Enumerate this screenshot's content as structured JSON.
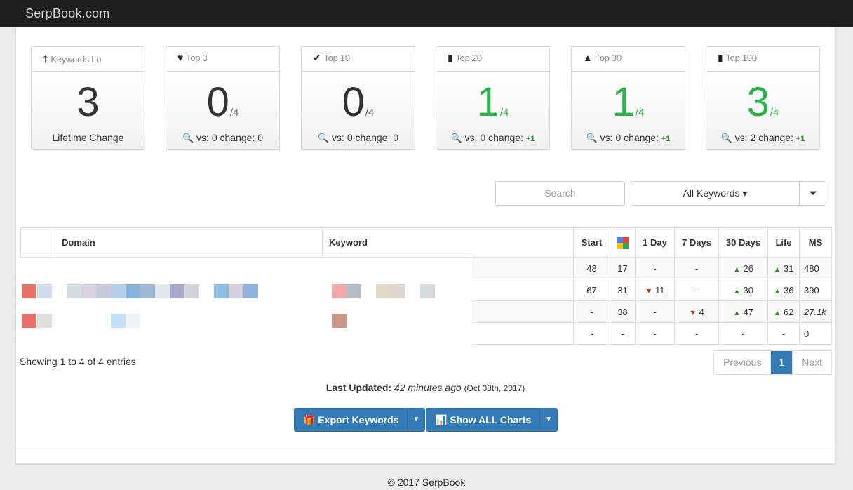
{
  "app": {
    "brand": "SerpBook.com"
  },
  "stats": [
    {
      "icon": "arrow-up-icon",
      "glyph": "🡑",
      "title": "Keywords Lo",
      "value": "3",
      "denominator": "",
      "green": false,
      "footer": "Lifetime Change",
      "vs": "",
      "change": "",
      "change_plus": ""
    },
    {
      "icon": "heart-icon",
      "glyph": "♥",
      "title": "Top 3",
      "value": "0",
      "denominator": "/4",
      "green": false,
      "footer": "",
      "vs": "vs: 0",
      "change": "change: 0",
      "change_plus": ""
    },
    {
      "icon": "check-icon",
      "glyph": "✔",
      "title": "Top 10",
      "value": "0",
      "denominator": "/4",
      "green": false,
      "footer": "",
      "vs": "vs: 0",
      "change": "change: 0",
      "change_plus": ""
    },
    {
      "icon": "bookmark-icon",
      "glyph": "🔖",
      "title": "Top 20",
      "value": "1",
      "denominator": "/4",
      "green": true,
      "footer": "",
      "vs": "vs: 0",
      "change": "change:",
      "change_plus": "+1"
    },
    {
      "icon": "road-icon",
      "glyph": "▲",
      "title": "Top 30",
      "value": "1",
      "denominator": "/4",
      "green": true,
      "footer": "",
      "vs": "vs: 0",
      "change": "change:",
      "change_plus": "+1"
    },
    {
      "icon": "signal-icon",
      "glyph": "▮",
      "title": "Top 100",
      "value": "3",
      "denominator": "/4",
      "green": true,
      "footer": "",
      "vs": "vs: 2",
      "change": "change:",
      "change_plus": "+1"
    }
  ],
  "toolbar": {
    "search_placeholder": "Search",
    "filter_label": "All Keywords ▾",
    "filter_icon": "filter-icon"
  },
  "table": {
    "headers": {
      "domain": "Domain",
      "keyword": "Keyword",
      "start": "Start",
      "google": "google-icon",
      "day1": "1 Day",
      "day7": "7 Days",
      "day30": "30 Days",
      "life": "Life",
      "ms": "MS"
    },
    "rows": [
      {
        "start": "48",
        "google": "17",
        "day1": "-",
        "day1_dir": "",
        "day7": "-",
        "day7_dir": "",
        "day30": "26",
        "day30_dir": "up",
        "life": "31",
        "life_dir": "up",
        "ms": "480"
      },
      {
        "start": "67",
        "google": "31",
        "day1": "11",
        "day1_dir": "down",
        "day7": "-",
        "day7_dir": "",
        "day30": "30",
        "day30_dir": "up",
        "life": "36",
        "life_dir": "up",
        "ms": "390"
      },
      {
        "start": "-",
        "google": "38",
        "day1": "-",
        "day1_dir": "",
        "day7": "4",
        "day7_dir": "down",
        "day30": "47",
        "day30_dir": "up",
        "life": "62",
        "life_dir": "up",
        "ms": "27.1k"
      },
      {
        "start": "-",
        "google": "-",
        "day1": "-",
        "day1_dir": "",
        "day7": "-",
        "day7_dir": "",
        "day30": "-",
        "day30_dir": "",
        "life": "-",
        "life_dir": "",
        "ms": "0"
      }
    ]
  },
  "footer_info": {
    "entries": "Showing 1 to 4 of 4 entries",
    "pager_prev": "Previous",
    "pager_page": "1",
    "pager_next": "Next",
    "updated_label": "Last Updated:",
    "updated_ago": "42 minutes ago",
    "updated_date": "(Oct 08th, 2017)"
  },
  "actions": {
    "export_label": "Export Keywords",
    "charts_label": "Show ALL Charts"
  },
  "copyright": "© 2017 SerpBook",
  "colors": {
    "green": "#2bb24c",
    "primary": "#337ab7",
    "topbar": "#1f1f1f"
  }
}
